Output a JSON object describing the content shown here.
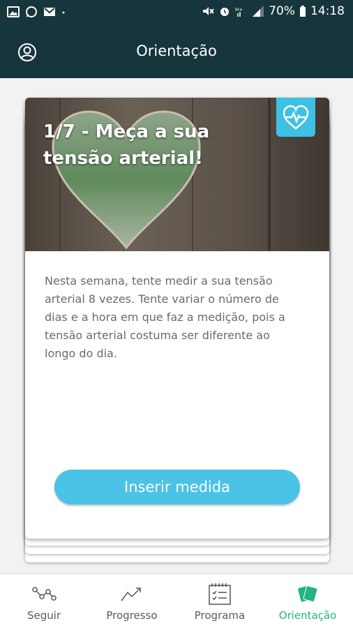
{
  "status_bar": {
    "battery": "70%",
    "time": "14:18"
  },
  "app_bar": {
    "title": "Orientação"
  },
  "card": {
    "title": "1/7 - Meça a sua tensão arterial!",
    "body": "Nesta semana, tente medir a sua tensão arterial 8 vezes. Tente variar o número de dias e a hora em que faz a medição, pois a tensão arterial costuma ser diferente ao longo do dia.",
    "button_label": "Inserir medida",
    "badge_icon": "heart-pulse-icon"
  },
  "bottom_nav": {
    "items": [
      {
        "label": "Seguir",
        "icon": "nodes-icon"
      },
      {
        "label": "Progresso",
        "icon": "trend-icon"
      },
      {
        "label": "Programa",
        "icon": "calendar-checklist-icon"
      },
      {
        "label": "Orientação",
        "icon": "cards-icon"
      }
    ],
    "active_color": "#20b583"
  },
  "colors": {
    "header": "#16353d",
    "accent": "#4bc3e6",
    "active_tab": "#20b583"
  }
}
